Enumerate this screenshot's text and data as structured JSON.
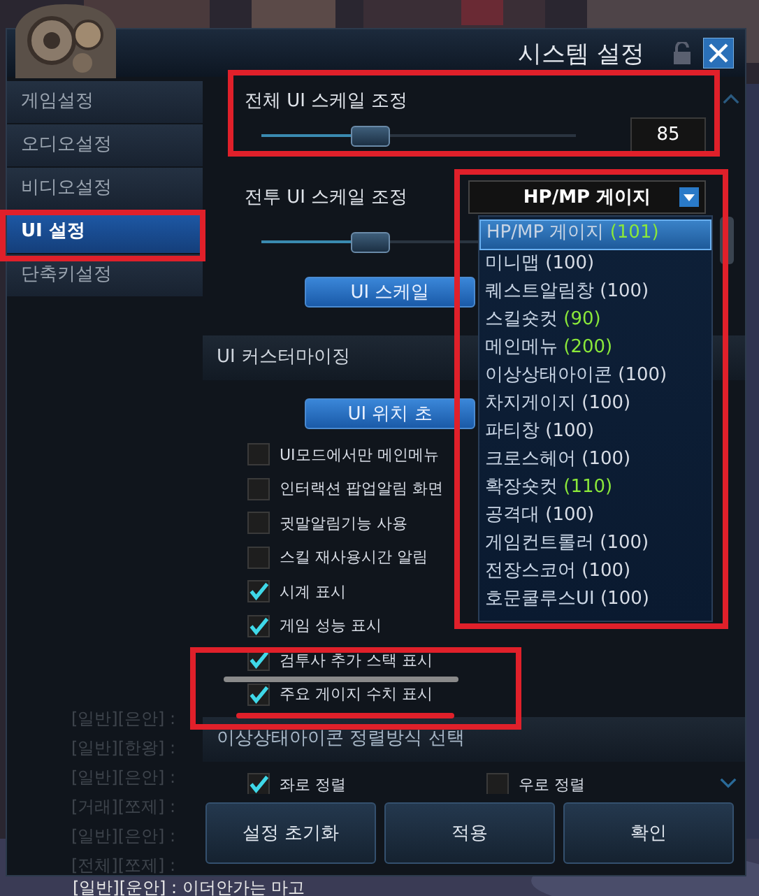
{
  "window": {
    "title": "시스템 설정"
  },
  "sidebar": {
    "items": [
      {
        "label": "게임설정",
        "selected": false
      },
      {
        "label": "오디오설정",
        "selected": false
      },
      {
        "label": "비디오설정",
        "selected": false
      },
      {
        "label": "UI 설정",
        "selected": true
      },
      {
        "label": "단축키설정",
        "selected": false
      }
    ]
  },
  "chat": [
    "[일반][은안] :",
    "[일반][한왕] :",
    "[일반][은안] :",
    "[거래][쪼제] :",
    "[일반][은안] :",
    "[전체][쪼제] :"
  ],
  "chat_bottom": "[일반][운안] : 이더안가는 마고",
  "scale": {
    "label": "전체 UI 스케일 조정",
    "level": 0.34,
    "value": "85"
  },
  "combat_scale": {
    "label": "전투 UI 스케일 조정",
    "level": 0.34,
    "button": "UI 스케일",
    "dropdown": {
      "value": "HP/MP 게이지",
      "options": [
        {
          "name": "HP/MP 게이지",
          "value": "(101)",
          "changed": true,
          "selected": true
        },
        {
          "name": "미니맵",
          "value": "(100)",
          "changed": false,
          "selected": false
        },
        {
          "name": "퀘스트알림창",
          "value": "(100)",
          "changed": false,
          "selected": false
        },
        {
          "name": "스킬숏컷",
          "value": "(90)",
          "changed": true,
          "selected": false
        },
        {
          "name": "메인메뉴",
          "value": "(200)",
          "changed": true,
          "selected": false
        },
        {
          "name": "이상상태아이콘",
          "value": "(100)",
          "changed": false,
          "selected": false
        },
        {
          "name": "차지게이지",
          "value": "(100)",
          "changed": false,
          "selected": false
        },
        {
          "name": "파티창",
          "value": "(100)",
          "changed": false,
          "selected": false
        },
        {
          "name": "크로스헤어",
          "value": "(100)",
          "changed": false,
          "selected": false
        },
        {
          "name": "확장숏컷",
          "value": "(110)",
          "changed": true,
          "selected": false
        },
        {
          "name": "공격대",
          "value": "(100)",
          "changed": false,
          "selected": false
        },
        {
          "name": "게임컨트롤러",
          "value": "(100)",
          "changed": false,
          "selected": false
        },
        {
          "name": "전장스코어",
          "value": "(100)",
          "changed": false,
          "selected": false
        },
        {
          "name": "호문쿨루스UI",
          "value": "(100)",
          "changed": false,
          "selected": false
        }
      ]
    }
  },
  "customizing": {
    "title": "UI 커스터마이징",
    "button": "UI 위치 초",
    "options": [
      {
        "label": "UI모드에서만 메인메뉴",
        "checked": false
      },
      {
        "label": "인터랙션 팝업알림 화면",
        "checked": false
      },
      {
        "label": "귓말알림기능 사용",
        "checked": false
      },
      {
        "label": "스킬 재사용시간 알림",
        "checked": false
      },
      {
        "label": "시계 표시",
        "checked": true
      },
      {
        "label": "게임 성능 표시",
        "checked": true
      },
      {
        "label": "검투사 추가 스택 표시",
        "checked": true
      },
      {
        "label": "주요 게이지 수치 표시",
        "checked": true
      }
    ]
  },
  "icon_align": {
    "title": "이상상태아이콘 정렬방식 선택",
    "options": [
      {
        "label": "좌로 정렬",
        "checked": true
      },
      {
        "label": "우로 정렬",
        "checked": false
      }
    ]
  },
  "buttons": [
    "설정 초기화",
    "적용",
    "확인"
  ]
}
